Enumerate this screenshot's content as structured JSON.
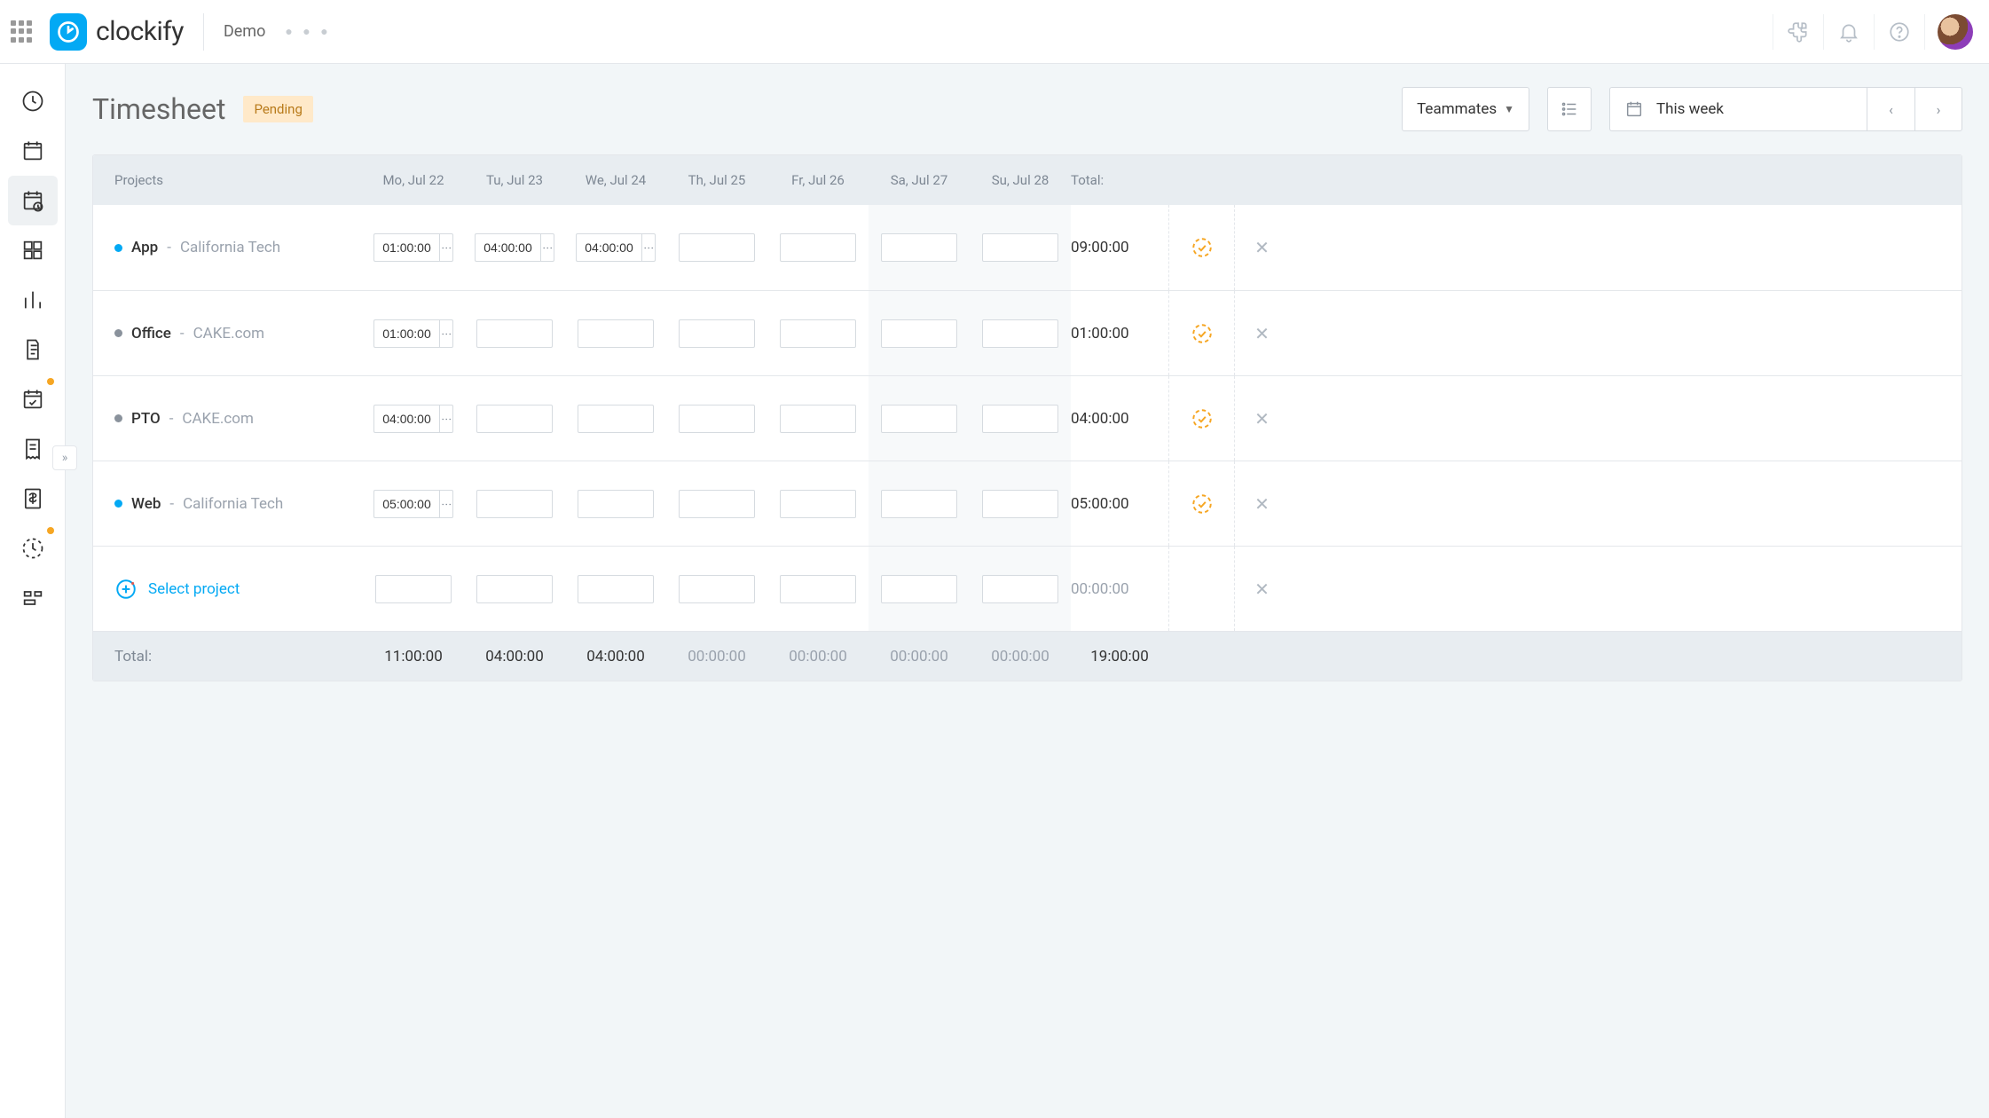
{
  "header": {
    "workspace": "Demo",
    "title": "Timesheet",
    "status_badge": "Pending",
    "teammates_label": "Teammates",
    "date_range": "This week"
  },
  "colors": {
    "accent": "#03a9f4",
    "pending_bg": "#ffe9c9",
    "pending_fg": "#b87a1a",
    "status_icon": "#f6a623"
  },
  "columns": {
    "projects_label": "Projects",
    "days": [
      "Mo, Jul 22",
      "Tu, Jul 23",
      "We, Jul 24",
      "Th, Jul 25",
      "Fr, Jul 26",
      "Sa, Jul 27",
      "Su, Jul 28"
    ],
    "total_label": "Total:"
  },
  "rows": [
    {
      "bullet_color": "#03a9f4",
      "name": "App",
      "client": "California Tech",
      "cells": [
        "01:00:00",
        "04:00:00",
        "04:00:00",
        "",
        "",
        "",
        ""
      ],
      "kebab": [
        true,
        true,
        true,
        false,
        false,
        false,
        false
      ],
      "total": "09:00:00",
      "has_status": true
    },
    {
      "bullet_color": "#8a929c",
      "name": "Office",
      "client": "CAKE.com",
      "cells": [
        "01:00:00",
        "",
        "",
        "",
        "",
        "",
        ""
      ],
      "kebab": [
        true,
        false,
        false,
        false,
        false,
        false,
        false
      ],
      "total": "01:00:00",
      "has_status": true
    },
    {
      "bullet_color": "#8a929c",
      "name": "PTO",
      "client": "CAKE.com",
      "cells": [
        "04:00:00",
        "",
        "",
        "",
        "",
        "",
        ""
      ],
      "kebab": [
        true,
        false,
        false,
        false,
        false,
        false,
        false
      ],
      "total": "04:00:00",
      "has_status": true
    },
    {
      "bullet_color": "#03a9f4",
      "name": "Web",
      "client": "California Tech",
      "cells": [
        "05:00:00",
        "",
        "",
        "",
        "",
        "",
        ""
      ],
      "kebab": [
        true,
        false,
        false,
        false,
        false,
        false,
        false
      ],
      "total": "05:00:00",
      "has_status": true
    }
  ],
  "new_row": {
    "label": "Select project",
    "cells": [
      "",
      "",
      "",
      "",
      "",
      "",
      ""
    ],
    "total": "00:00:00"
  },
  "footer": {
    "label": "Total:",
    "totals": [
      "11:00:00",
      "04:00:00",
      "04:00:00",
      "00:00:00",
      "00:00:00",
      "00:00:00",
      "00:00:00"
    ],
    "grand_total": "19:00:00"
  }
}
